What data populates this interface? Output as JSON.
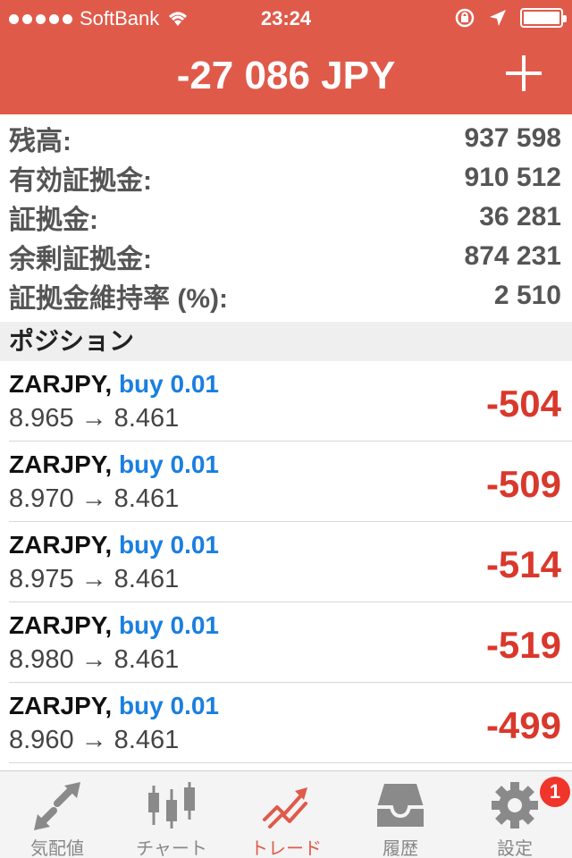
{
  "status_bar": {
    "carrier": "SoftBank",
    "time": "23:24"
  },
  "header": {
    "total": "-27 086 JPY",
    "add_icon": "plus-icon"
  },
  "summary": [
    {
      "label": "残高:",
      "value": "937 598"
    },
    {
      "label": "有効証拠金:",
      "value": "910 512"
    },
    {
      "label": "証拠金:",
      "value": "36 281"
    },
    {
      "label": "余剰証拠金:",
      "value": "874 231"
    },
    {
      "label": "証拠金維持率 (%):",
      "value": "2 510"
    }
  ],
  "section": {
    "title": "ポジション"
  },
  "positions": [
    {
      "symbol": "ZARJPY,",
      "side": "buy 0.01",
      "prices": "8.965 → 8.461",
      "pnl": "-504"
    },
    {
      "symbol": "ZARJPY,",
      "side": "buy 0.01",
      "prices": "8.970 → 8.461",
      "pnl": "-509"
    },
    {
      "symbol": "ZARJPY,",
      "side": "buy 0.01",
      "prices": "8.975 → 8.461",
      "pnl": "-514"
    },
    {
      "symbol": "ZARJPY,",
      "side": "buy 0.01",
      "prices": "8.980 → 8.461",
      "pnl": "-519"
    },
    {
      "symbol": "ZARJPY,",
      "side": "buy 0.01",
      "prices": "8.960 → 8.461",
      "pnl": "-499"
    }
  ],
  "tabs": [
    {
      "label": "気配値",
      "icon": "quotes-arrows-icon"
    },
    {
      "label": "チャート",
      "icon": "candlestick-chart-icon"
    },
    {
      "label": "トレード",
      "icon": "trade-icon"
    },
    {
      "label": "履歴",
      "icon": "history-inbox-icon"
    },
    {
      "label": "設定",
      "icon": "gear-icon",
      "badge": "1"
    }
  ],
  "colors": {
    "accent": "#e05a4a",
    "loss": "#d9382c",
    "buy": "#1a7fe0"
  }
}
